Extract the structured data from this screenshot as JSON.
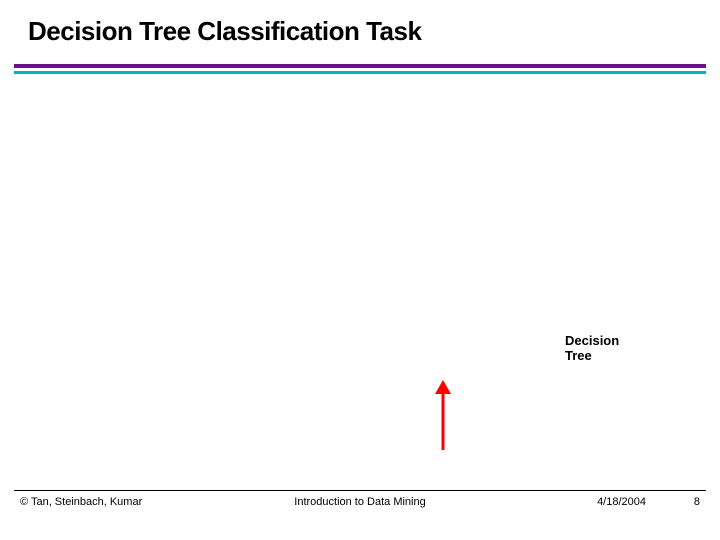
{
  "title": "Decision Tree Classification Task",
  "annotation": {
    "line1": "Decision",
    "line2": "Tree"
  },
  "footer": {
    "authors": "© Tan, Steinbach, Kumar",
    "center": "Introduction to Data Mining",
    "date": "4/18/2004",
    "page": "8"
  }
}
